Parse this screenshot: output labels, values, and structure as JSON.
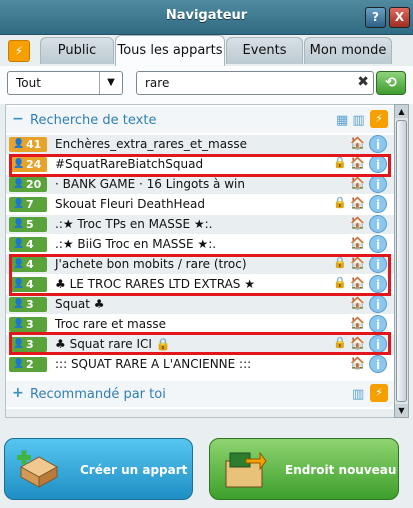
{
  "window": {
    "title": "Navigateur",
    "help_label": "?",
    "close_label": "X"
  },
  "tabs": [
    {
      "label": "Public"
    },
    {
      "label": "Tous les apparts"
    },
    {
      "label": "Events"
    },
    {
      "label": "Mon monde"
    }
  ],
  "filter": {
    "selected": "Tout"
  },
  "search": {
    "value": "rare"
  },
  "section_text": {
    "label": "Recherche de texte",
    "toggle": "−"
  },
  "rooms": [
    {
      "count": "41",
      "name": "Enchères_extra_rares_et_masse",
      "color": "#e8a22a",
      "lock": false
    },
    {
      "count": "24",
      "name": "#SquatRareBiatchSquad",
      "color": "#e8a22a",
      "lock": true
    },
    {
      "count": "20",
      "name": "· BANK GAME · 16 Lingots à win",
      "color": "#5aa33a",
      "lock": false
    },
    {
      "count": "7",
      "name": "Skouat Fleuri DeathHead",
      "color": "#5aa33a",
      "lock": true
    },
    {
      "count": "5",
      "name": ".:★ Troc TPs en MASSE ★:.",
      "color": "#5aa33a",
      "lock": false
    },
    {
      "count": "4",
      "name": ".:★ BiiG Troc en MASSE ★:.",
      "color": "#5aa33a",
      "lock": false
    },
    {
      "count": "4",
      "name": "J'achete bon mobits / rare (troc)",
      "color": "#5aa33a",
      "lock": true
    },
    {
      "count": "4",
      "name": "♣ LE TROC RARES LTD EXTRAS ★",
      "color": "#5aa33a",
      "lock": true
    },
    {
      "count": "3",
      "name": "Squat ♣",
      "color": "#5aa33a",
      "lock": false
    },
    {
      "count": "3",
      "name": "Troc rare et masse",
      "color": "#5aa33a",
      "lock": false
    },
    {
      "count": "3",
      "name": "♣ Squat rare ICI 🔒",
      "color": "#5aa33a",
      "lock": true
    },
    {
      "count": "2",
      "name": "::: SQUAT RARE A L'ANCIENNE :::",
      "color": "#5aa33a",
      "lock": false
    }
  ],
  "section_recommended": {
    "label": "Recommandé par toi",
    "toggle": "+"
  },
  "buttons": {
    "create": "Créer un appart",
    "new_place": "Endroit nouveau"
  }
}
